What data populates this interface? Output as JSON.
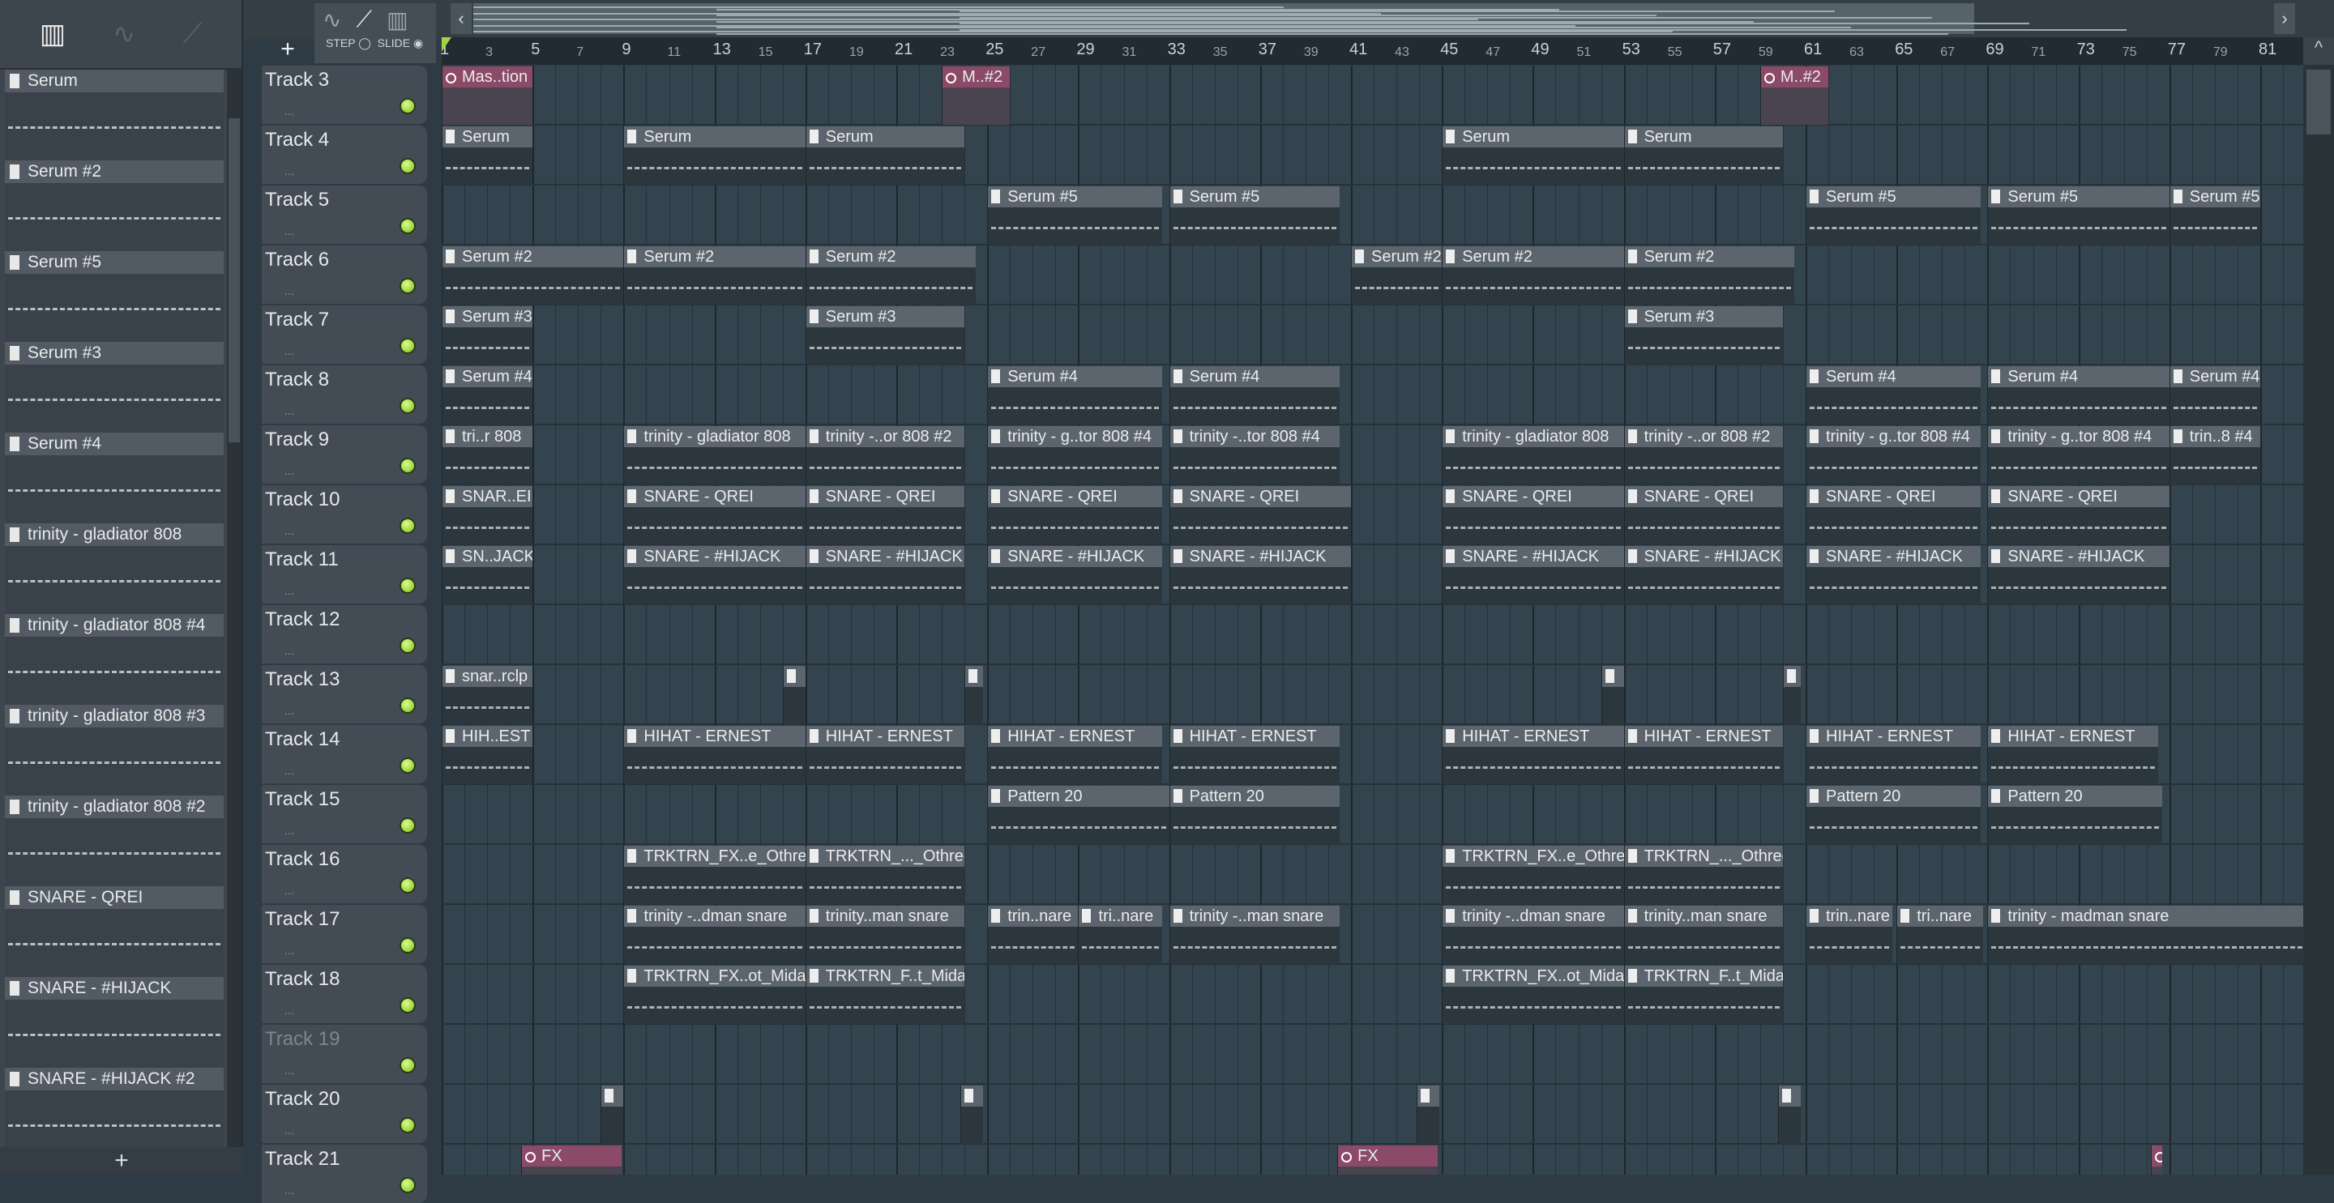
{
  "toolbar": {
    "step_label": "STEP",
    "slide_label": "SLIDE",
    "add_track": "+",
    "nav_left": "‹",
    "nav_right": "›"
  },
  "picker": {
    "tools": [
      "piano-roll-icon",
      "audio-icon",
      "automation-icon"
    ],
    "add": "+",
    "items": [
      "Serum",
      "Serum #2",
      "Serum #5",
      "Serum #3",
      "Serum #4",
      "trinity - gladiator 808",
      "trinity - gladiator 808 #4",
      "trinity - gladiator 808 #3",
      "trinity - gladiator 808 #2",
      "SNARE - QREI",
      "SNARE - #HIJACK",
      "SNARE - #HIJACK #2"
    ]
  },
  "ruler": {
    "first_bar": 1,
    "last_bar": 81
  },
  "tracks": [
    {
      "name": "Track 3",
      "clips": [
        {
          "t": "Mas..tion",
          "s": 1,
          "l": 4,
          "k": "auto"
        },
        {
          "t": "M..#2",
          "s": 23,
          "l": 3,
          "k": "auto"
        },
        {
          "t": "M..#2",
          "s": 59,
          "l": 3,
          "k": "auto"
        }
      ]
    },
    {
      "name": "Track 4",
      "clips": [
        {
          "t": "Serum",
          "s": 1,
          "l": 4
        },
        {
          "t": "Serum",
          "s": 9,
          "l": 8
        },
        {
          "t": "Serum",
          "s": 17,
          "l": 7
        },
        {
          "t": "Serum",
          "s": 45,
          "l": 8
        },
        {
          "t": "Serum",
          "s": 53,
          "l": 7
        }
      ]
    },
    {
      "name": "Track 5",
      "clips": [
        {
          "t": "Serum #5",
          "s": 25,
          "l": 7.7
        },
        {
          "t": "Serum #5",
          "s": 33,
          "l": 7.5
        },
        {
          "t": "Serum #5",
          "s": 61,
          "l": 7.7
        },
        {
          "t": "Serum #5",
          "s": 69,
          "l": 8
        },
        {
          "t": "Serum #5",
          "s": 77,
          "l": 4
        }
      ]
    },
    {
      "name": "Track 6",
      "clips": [
        {
          "t": "Serum #2",
          "s": 1,
          "l": 8
        },
        {
          "t": "Serum #2",
          "s": 9,
          "l": 8
        },
        {
          "t": "Serum #2",
          "s": 17,
          "l": 7.5
        },
        {
          "t": "Serum #2",
          "s": 41,
          "l": 4
        },
        {
          "t": "Serum #2",
          "s": 45,
          "l": 8
        },
        {
          "t": "Serum #2",
          "s": 53,
          "l": 7.5
        }
      ]
    },
    {
      "name": "Track 7",
      "clips": [
        {
          "t": "Serum #3",
          "s": 1,
          "l": 4
        },
        {
          "t": "Serum #3",
          "s": 17,
          "l": 7
        },
        {
          "t": "Serum #3",
          "s": 53,
          "l": 7
        }
      ]
    },
    {
      "name": "Track 8",
      "clips": [
        {
          "t": "Serum #4",
          "s": 1,
          "l": 4
        },
        {
          "t": "Serum #4",
          "s": 25,
          "l": 7.7
        },
        {
          "t": "Serum #4",
          "s": 33,
          "l": 7.5
        },
        {
          "t": "Serum #4",
          "s": 61,
          "l": 7.7
        },
        {
          "t": "Serum #4",
          "s": 69,
          "l": 8
        },
        {
          "t": "Serum #4",
          "s": 77,
          "l": 4
        }
      ]
    },
    {
      "name": "Track 9",
      "clips": [
        {
          "t": "tri..r 808",
          "s": 1,
          "l": 4
        },
        {
          "t": "trinity - gladiator 808",
          "s": 9,
          "l": 8
        },
        {
          "t": "trinity -..or 808 #2",
          "s": 17,
          "l": 7
        },
        {
          "t": "trinity - g..tor 808 #4",
          "s": 25,
          "l": 7.7
        },
        {
          "t": "trinity -..tor 808 #4",
          "s": 33,
          "l": 7.5
        },
        {
          "t": "trinity - gladiator 808",
          "s": 45,
          "l": 8
        },
        {
          "t": "trinity -..or 808 #2",
          "s": 53,
          "l": 7
        },
        {
          "t": "trinity - g..tor 808 #4",
          "s": 61,
          "l": 7.7
        },
        {
          "t": "trinity - g..tor 808 #4",
          "s": 69,
          "l": 8
        },
        {
          "t": "trin..8 #4",
          "s": 77,
          "l": 4
        }
      ]
    },
    {
      "name": "Track 10",
      "clips": [
        {
          "t": "SNAR..EI",
          "s": 1,
          "l": 4
        },
        {
          "t": "SNARE - QREI",
          "s": 9,
          "l": 8
        },
        {
          "t": "SNARE - QREI",
          "s": 17,
          "l": 7
        },
        {
          "t": "SNARE - QREI",
          "s": 25,
          "l": 7.7
        },
        {
          "t": "SNARE - QREI",
          "s": 33,
          "l": 8
        },
        {
          "t": "SNARE - QREI",
          "s": 45,
          "l": 8
        },
        {
          "t": "SNARE - QREI",
          "s": 53,
          "l": 7
        },
        {
          "t": "SNARE - QREI",
          "s": 61,
          "l": 7.7
        },
        {
          "t": "SNARE - QREI",
          "s": 69,
          "l": 8
        }
      ]
    },
    {
      "name": "Track 11",
      "clips": [
        {
          "t": "SN..JACK",
          "s": 1,
          "l": 4
        },
        {
          "t": "SNARE - #HIJACK",
          "s": 9,
          "l": 8
        },
        {
          "t": "SNARE - #HIJACK",
          "s": 17,
          "l": 7
        },
        {
          "t": "SNARE - #HIJACK",
          "s": 25,
          "l": 7.7
        },
        {
          "t": "SNARE - #HIJACK",
          "s": 33,
          "l": 8
        },
        {
          "t": "SNARE - #HIJACK",
          "s": 45,
          "l": 8
        },
        {
          "t": "SNARE - #HIJACK",
          "s": 53,
          "l": 7
        },
        {
          "t": "SNARE - #HIJACK",
          "s": 61,
          "l": 7.7
        },
        {
          "t": "SNARE - #HIJACK",
          "s": 69,
          "l": 8
        }
      ]
    },
    {
      "name": "Track 12",
      "clips": []
    },
    {
      "name": "Track 13",
      "clips": [
        {
          "t": "snar..rclp",
          "s": 1,
          "l": 4
        },
        {
          "t": "",
          "s": 16,
          "l": 1,
          "k": "mini"
        },
        {
          "t": "",
          "s": 24,
          "l": 0.8,
          "k": "mini"
        },
        {
          "t": "",
          "s": 52,
          "l": 1,
          "k": "mini"
        },
        {
          "t": "",
          "s": 60,
          "l": 0.8,
          "k": "mini"
        }
      ]
    },
    {
      "name": "Track 14",
      "clips": [
        {
          "t": "HIH..EST",
          "s": 1,
          "l": 4
        },
        {
          "t": "HIHAT - ERNEST",
          "s": 9,
          "l": 8
        },
        {
          "t": "HIHAT - ERNEST",
          "s": 17,
          "l": 7
        },
        {
          "t": "HIHAT - ERNEST",
          "s": 25,
          "l": 7.7
        },
        {
          "t": "HIHAT - ERNEST",
          "s": 33,
          "l": 7.5
        },
        {
          "t": "HIHAT - ERNEST",
          "s": 45,
          "l": 8
        },
        {
          "t": "HIHAT - ERNEST",
          "s": 53,
          "l": 7
        },
        {
          "t": "HIHAT - ERNEST",
          "s": 61,
          "l": 7.7
        },
        {
          "t": "HIHAT - ERNEST",
          "s": 69,
          "l": 7.5
        }
      ]
    },
    {
      "name": "Track 15",
      "clips": [
        {
          "t": "Pattern 20",
          "s": 25,
          "l": 8
        },
        {
          "t": "Pattern 20",
          "s": 33,
          "l": 7.5
        },
        {
          "t": "Pattern 20",
          "s": 61,
          "l": 7.7
        },
        {
          "t": "Pattern 20",
          "s": 69,
          "l": 7.7
        }
      ]
    },
    {
      "name": "Track 16",
      "clips": [
        {
          "t": "TRKTRN_FX..e_Othree",
          "s": 9,
          "l": 8
        },
        {
          "t": "TRKTRN_..._Othree",
          "s": 17,
          "l": 7
        },
        {
          "t": "TRKTRN_FX..e_Othree",
          "s": 45,
          "l": 8
        },
        {
          "t": "TRKTRN_..._Othree",
          "s": 53,
          "l": 7
        }
      ]
    },
    {
      "name": "Track 17",
      "clips": [
        {
          "t": "trinity -..dman snare",
          "s": 9,
          "l": 8
        },
        {
          "t": "trinity..man snare",
          "s": 17,
          "l": 7
        },
        {
          "t": "trin..nare",
          "s": 25,
          "l": 4
        },
        {
          "t": "tri..nare",
          "s": 29,
          "l": 3.7
        },
        {
          "t": "trinity -..man snare",
          "s": 33,
          "l": 7.5
        },
        {
          "t": "trinity -..dman snare",
          "s": 45,
          "l": 8
        },
        {
          "t": "trinity..man snare",
          "s": 53,
          "l": 7
        },
        {
          "t": "trin..nare",
          "s": 61,
          "l": 3.8
        },
        {
          "t": "tri..nare",
          "s": 65,
          "l": 3.8
        },
        {
          "t": "trinity - madman snare",
          "s": 69,
          "l": 14
        }
      ]
    },
    {
      "name": "Track 18",
      "clips": [
        {
          "t": "TRKTRN_FX..ot_Midas",
          "s": 9,
          "l": 8
        },
        {
          "t": "TRKTRN_F..t_Midas",
          "s": 17,
          "l": 7
        },
        {
          "t": "TRKTRN_FX..ot_Midas",
          "s": 45,
          "l": 8
        },
        {
          "t": "TRKTRN_F..t_Midas",
          "s": 53,
          "l": 7
        }
      ]
    },
    {
      "name": "Track 19",
      "muted": true,
      "clips": []
    },
    {
      "name": "Track 20",
      "clips": [
        {
          "t": "",
          "s": 8,
          "l": 1,
          "k": "mini"
        },
        {
          "t": "",
          "s": 23.8,
          "l": 1,
          "k": "mini"
        },
        {
          "t": "",
          "s": 43.9,
          "l": 1,
          "k": "mini"
        },
        {
          "t": "",
          "s": 59.8,
          "l": 1,
          "k": "mini"
        }
      ]
    },
    {
      "name": "Track 21",
      "clips": [
        {
          "t": "FX",
          "s": 4.5,
          "l": 4.4,
          "k": "auto"
        },
        {
          "t": "FX",
          "s": 40.4,
          "l": 4.4,
          "k": "auto"
        },
        {
          "t": "",
          "s": 76.2,
          "l": 0.5,
          "k": "auto"
        }
      ]
    }
  ]
}
